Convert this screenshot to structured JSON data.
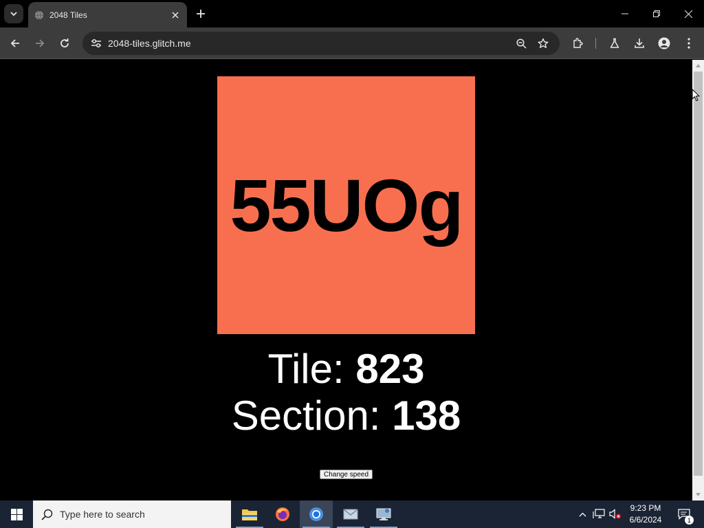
{
  "browser": {
    "tab_title": "2048 Tiles",
    "url": "2048-tiles.glitch.me"
  },
  "page": {
    "tile_text": "55UOg",
    "tile_color": "#f86f4f",
    "tile_label": "Tile:",
    "tile_number": "823",
    "section_label": "Section:",
    "section_number": "138",
    "change_speed_label": "Change speed"
  },
  "taskbar": {
    "search_placeholder": "Type here to search",
    "time": "9:23 PM",
    "date": "6/6/2024",
    "notification_count": "1",
    "apps": [
      "file-explorer",
      "firefox",
      "chrome",
      "mail-app",
      "remote-desktop"
    ]
  }
}
